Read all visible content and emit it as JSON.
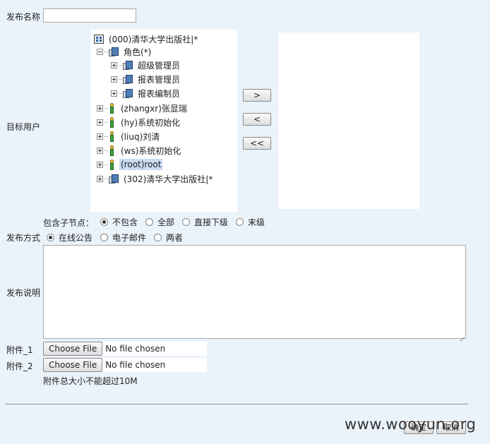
{
  "form": {
    "publish_name_label": "发布名称",
    "publish_name_value": "",
    "target_user_label": "目标用户",
    "include_children_label": "包含子节点：",
    "include_children_options": [
      "不包含",
      "全部",
      "直接下级",
      "末级"
    ],
    "include_children_selected": "不包含",
    "publish_method_label": "发布方式",
    "publish_method_options": [
      "在线公告",
      "电子邮件",
      "两者"
    ],
    "publish_method_selected": "在线公告",
    "description_label": "发布说明",
    "description_value": "",
    "attachment1_label": "附件_1",
    "attachment2_label": "附件_2",
    "choose_file_label": "Choose File",
    "no_file_text": "No file chosen",
    "attachment_hint": "附件总大小不能超过10M"
  },
  "tree": {
    "root": "(000)清华大学出版社|*",
    "roles_node": "角色(*)",
    "roles": [
      "超级管理员",
      "报表管理员",
      "报表编制员"
    ],
    "users": [
      "(zhangxr)张显瑞",
      "(hy)系统初始化",
      "(liuq)刘清",
      "(ws)系统初始化",
      "(root)root"
    ],
    "selected": "(root)root",
    "sub_org": "(302)清华大学出版社|*"
  },
  "transfer": {
    "add_label": ">",
    "remove_label": "<",
    "remove_all_label": "<<"
  },
  "footer": {
    "confirm_label": "确定",
    "cancel_label": "取消"
  },
  "watermark": "www.wooyun.org"
}
